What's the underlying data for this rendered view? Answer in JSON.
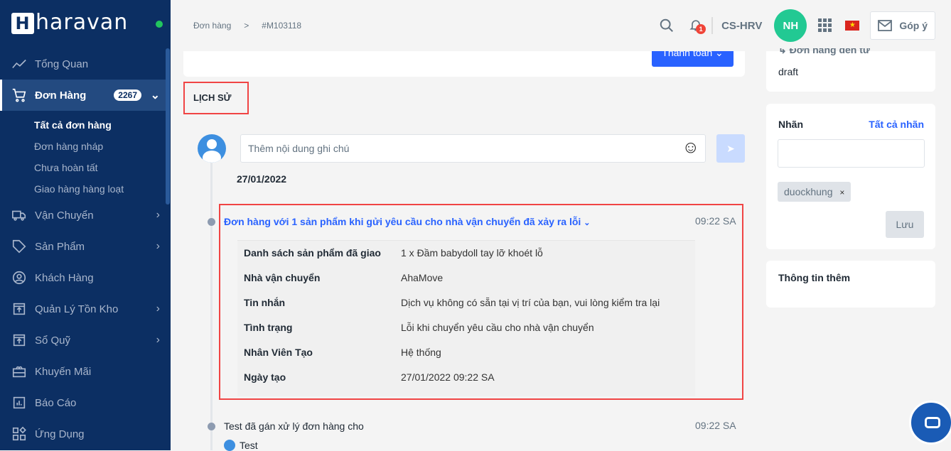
{
  "brand": {
    "name": "haravan"
  },
  "sidebar": {
    "items": [
      {
        "label": "Tổng Quan",
        "icon": "chart-line-icon"
      },
      {
        "label": "Đơn Hàng",
        "icon": "cart-icon",
        "badge": "2267"
      },
      {
        "label": "Vận Chuyển",
        "icon": "truck-icon"
      },
      {
        "label": "Sản Phẩm",
        "icon": "tag-icon"
      },
      {
        "label": "Khách Hàng",
        "icon": "user-circle-icon"
      },
      {
        "label": "Quản Lý Tồn Kho",
        "icon": "inventory-icon"
      },
      {
        "label": "Sổ Quỹ",
        "icon": "cashbook-icon"
      },
      {
        "label": "Khuyến Mãi",
        "icon": "gift-icon"
      },
      {
        "label": "Báo Cáo",
        "icon": "report-icon"
      },
      {
        "label": "Ứng Dụng",
        "icon": "apps-icon"
      }
    ],
    "sub": [
      "Tất cả đơn hàng",
      "Đơn hàng nháp",
      "Chưa hoàn tất",
      "Giao hàng hàng loạt"
    ]
  },
  "header": {
    "breadcrumb": [
      "Đơn hàng",
      "#M103118"
    ],
    "notif_count": "1",
    "store": "CS-HRV",
    "avatar": "NH",
    "feedback": "Góp ý"
  },
  "main": {
    "pay_button": "Thanh toán",
    "history_title": "LỊCH SỬ",
    "note_placeholder": "Thêm nội dung ghi chú",
    "date": "27/01/2022",
    "event1": {
      "title": "Đơn hàng với 1 sản phẩm khi gửi yêu cầu cho nhà vận chuyển đã xảy ra lỗi",
      "time": "09:22 SA",
      "rows": [
        {
          "k": "Danh sách sản phẩm đã giao",
          "v": "1 x Đầm babydoll tay lỡ khoét lỗ"
        },
        {
          "k": "Nhà vận chuyển",
          "v": "AhaMove"
        },
        {
          "k": "Tin nhắn",
          "v": "Dịch vụ không có sẵn tại vị trí của bạn, vui lòng kiểm tra lại"
        },
        {
          "k": "Tình trạng",
          "v": "Lỗi khi chuyển yêu cầu cho nhà vận chuyển"
        },
        {
          "k": "Nhân Viên Tạo",
          "v": "Hệ thống"
        },
        {
          "k": "Ngày tạo",
          "v": "27/01/2022 09:22 SA"
        }
      ]
    },
    "event2": {
      "title": "Test đã gán xử lý đơn hàng cho",
      "time": "09:22 SA",
      "user": "Test"
    }
  },
  "right": {
    "source_label": "Đơn hàng đến từ",
    "source": "draft",
    "tags_title": "Nhãn",
    "all_tags": "Tất cả nhãn",
    "tag": "duockhung",
    "save": "Lưu",
    "more_title": "Thông tin thêm"
  },
  "colors": {
    "sidebar": "#0c2f63",
    "accent": "#2962ff",
    "highlight": "#f04444"
  }
}
